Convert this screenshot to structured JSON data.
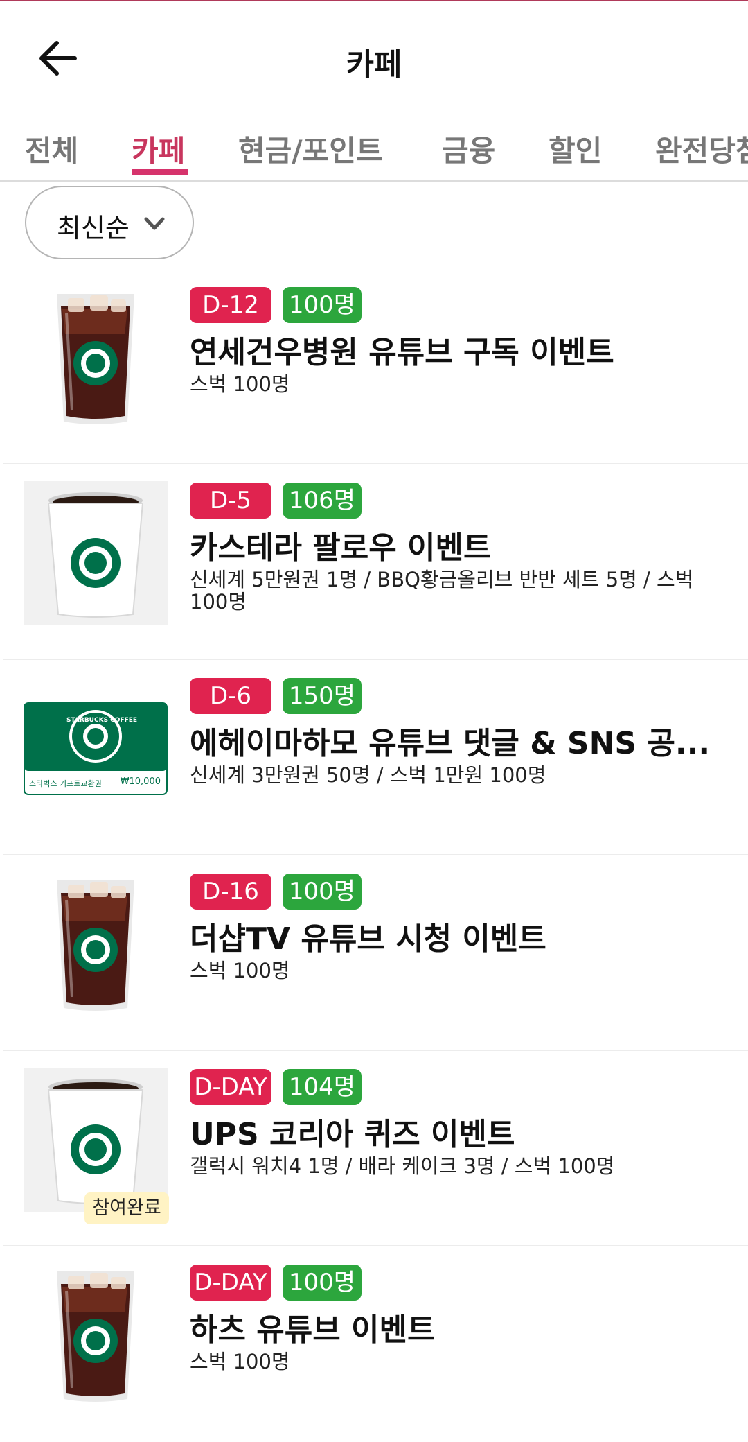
{
  "header": {
    "title": "카페"
  },
  "tabs": [
    {
      "label": "전체"
    },
    {
      "label": "카페"
    },
    {
      "label": "현금/포인트"
    },
    {
      "label": "금융"
    },
    {
      "label": "할인"
    },
    {
      "label": "완전당첨"
    }
  ],
  "active_tab": "카페",
  "sort": {
    "label": "최신순"
  },
  "items": [
    {
      "dday": "D-12",
      "count": "100명",
      "title": "연세건우병원 유튜브 구독 이벤트",
      "desc": "스벅 100명",
      "image": "iced-americano-cup"
    },
    {
      "dday": "D-5",
      "count": "106명",
      "title": "카스테라 팔로우 이벤트",
      "desc": "신세계 5만원권 1명 / BBQ황금올리브 반반 세트 5명 / 스벅 100명",
      "image": "hot-coffee-cup"
    },
    {
      "dday": "D-6",
      "count": "150명",
      "title": "에헤이마하모 유튜브 댓글 & SNS 공...",
      "desc": "신세계 3만원권 50명 / 스벅 1만원 100명",
      "image": "starbucks-gift-card",
      "card_brand": "STARBUCKS COFFEE",
      "card_caption": "스타벅스 기프트교환권",
      "card_amount": "₩10,000"
    },
    {
      "dday": "D-16",
      "count": "100명",
      "title": "더샵TV 유튜브 시청 이벤트",
      "desc": "스벅 100명",
      "image": "iced-americano-cup"
    },
    {
      "dday": "D-DAY",
      "count": "104명",
      "title": "UPS 코리아 퀴즈 이벤트",
      "desc": "갤럭시 워치4 1명 / 배라 케이크 3명 / 스벅 100명",
      "image": "hot-coffee-cup",
      "status": "참여완료"
    },
    {
      "dday": "D-DAY",
      "count": "100명",
      "title": "하츠 유튜브 이벤트",
      "desc": "스벅 100명",
      "image": "iced-americano-cup"
    }
  ],
  "colors": {
    "accent": "#d6336c",
    "dday_badge": "#e0234f",
    "count_badge": "#2ca63d",
    "starbucks_green": "#00704a"
  }
}
